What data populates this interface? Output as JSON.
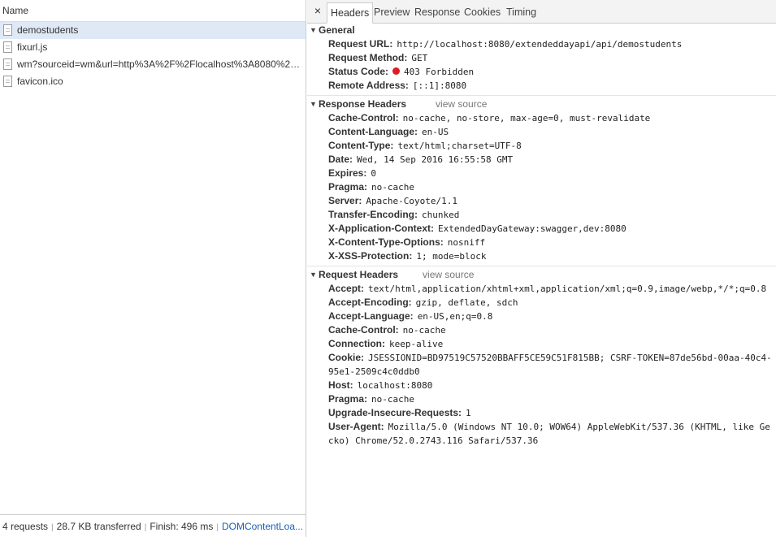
{
  "requests_panel": {
    "header": "Name",
    "files": [
      {
        "name": "demostudents",
        "selected": true
      },
      {
        "name": "fixurl.js",
        "selected": false
      },
      {
        "name": "wm?sourceid=wm&url=http%3A%2F%2Flocalhost%3A8080%2Fextend...",
        "selected": false
      },
      {
        "name": "favicon.ico",
        "selected": false
      }
    ],
    "status_bar": {
      "requests": "4 requests",
      "transferred": "28.7 KB transferred",
      "finish": "Finish: 496 ms",
      "domcontent": "DOMContentLoa..."
    }
  },
  "details_panel": {
    "close": "×",
    "tabs": [
      "Headers",
      "Preview",
      "Response",
      "Cookies",
      "Timing"
    ],
    "active_tab": "Headers",
    "general": {
      "title": "General",
      "rows": [
        {
          "k": "Request URL:",
          "v": "http://localhost:8080/extendeddayapi/api/demostudents"
        },
        {
          "k": "Request Method:",
          "v": "GET"
        },
        {
          "k": "Status Code:",
          "v": "403 Forbidden"
        },
        {
          "k": "Remote Address:",
          "v": "[::1]:8080"
        }
      ]
    },
    "response_headers": {
      "title": "Response Headers",
      "view_source": "view source",
      "rows": [
        {
          "k": "Cache-Control:",
          "v": "no-cache, no-store, max-age=0, must-revalidate"
        },
        {
          "k": "Content-Language:",
          "v": "en-US"
        },
        {
          "k": "Content-Type:",
          "v": "text/html;charset=UTF-8"
        },
        {
          "k": "Date:",
          "v": "Wed, 14 Sep 2016 16:55:58 GMT"
        },
        {
          "k": "Expires:",
          "v": "0"
        },
        {
          "k": "Pragma:",
          "v": "no-cache"
        },
        {
          "k": "Server:",
          "v": "Apache-Coyote/1.1"
        },
        {
          "k": "Transfer-Encoding:",
          "v": "chunked"
        },
        {
          "k": "X-Application-Context:",
          "v": "ExtendedDayGateway:swagger,dev:8080"
        },
        {
          "k": "X-Content-Type-Options:",
          "v": "nosniff"
        },
        {
          "k": "X-XSS-Protection:",
          "v": "1; mode=block"
        }
      ]
    },
    "request_headers": {
      "title": "Request Headers",
      "view_source": "view source",
      "rows": [
        {
          "k": "Accept:",
          "v": "text/html,application/xhtml+xml,application/xml;q=0.9,image/webp,*/*;q=0.8"
        },
        {
          "k": "Accept-Encoding:",
          "v": "gzip, deflate, sdch"
        },
        {
          "k": "Accept-Language:",
          "v": "en-US,en;q=0.8"
        },
        {
          "k": "Cache-Control:",
          "v": "no-cache"
        },
        {
          "k": "Connection:",
          "v": "keep-alive"
        },
        {
          "k": "Cookie:",
          "v": "JSESSIONID=BD97519C57520BBAFF5CE59C51F815BB; CSRF-TOKEN=87de56bd-00aa-40c4-95e1-2509c4c0ddb0"
        },
        {
          "k": "Host:",
          "v": "localhost:8080"
        },
        {
          "k": "Pragma:",
          "v": "no-cache"
        },
        {
          "k": "Upgrade-Insecure-Requests:",
          "v": "1"
        },
        {
          "k": "User-Agent:",
          "v": "Mozilla/5.0 (Windows NT 10.0; WOW64) AppleWebKit/537.36 (KHTML, like Gecko) Chrome/52.0.2743.116 Safari/537.36"
        }
      ]
    },
    "colors": {
      "status_dot": "#e01b24",
      "selected_row": "#dfe9f6",
      "link": "#1a5fb4"
    }
  }
}
